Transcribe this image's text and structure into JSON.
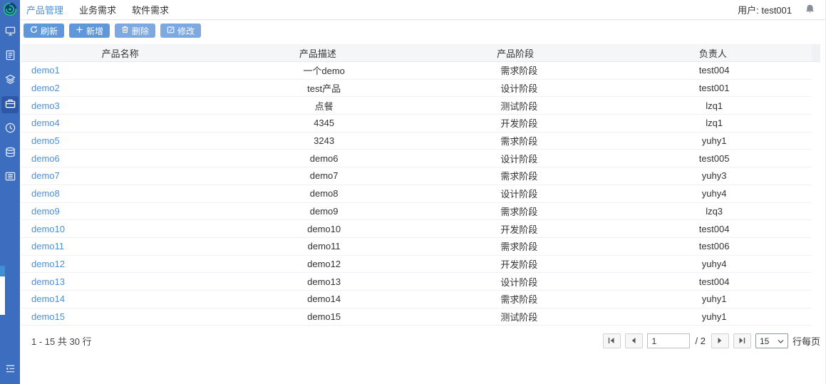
{
  "colors": {
    "sidebar": "#3d6dbf",
    "accent": "#4a90db",
    "button_primary": "#5f97d8",
    "button_muted": "#7da8e0",
    "logo_green": "#2abd87"
  },
  "sidebar": {
    "logo_icon": "spiral-logo-icon",
    "items": [
      {
        "icon": "monitor-icon",
        "active": false
      },
      {
        "icon": "document-icon",
        "active": false
      },
      {
        "icon": "layers-icon",
        "active": false
      },
      {
        "icon": "briefcase-icon",
        "active": true
      },
      {
        "icon": "clock-icon",
        "active": false
      },
      {
        "icon": "database-icon",
        "active": false
      },
      {
        "icon": "list-icon",
        "active": false
      }
    ],
    "collapse_icon": "collapse-menu-icon"
  },
  "topbar": {
    "tabs": [
      {
        "label": "产品管理",
        "active": true
      },
      {
        "label": "业务需求",
        "active": false
      },
      {
        "label": "软件需求",
        "active": false
      }
    ],
    "user_label": "用户: test001",
    "bell_icon": "bell-icon"
  },
  "toolbar": {
    "buttons": [
      {
        "label": "刷新",
        "icon": "refresh-icon"
      },
      {
        "label": "新增",
        "icon": "plus-icon"
      },
      {
        "label": "删除",
        "icon": "trash-icon"
      },
      {
        "label": "修改",
        "icon": "edit-icon"
      }
    ]
  },
  "table": {
    "columns": [
      "产品名称",
      "产品描述",
      "产品阶段",
      "负责人"
    ],
    "rows": [
      [
        "demo1",
        "一个demo",
        "需求阶段",
        "test004"
      ],
      [
        "demo2",
        "test产品",
        "设计阶段",
        "test001"
      ],
      [
        "demo3",
        "点餐",
        "测试阶段",
        "lzq1"
      ],
      [
        "demo4",
        "4345",
        "开发阶段",
        "lzq1"
      ],
      [
        "demo5",
        "3243",
        "需求阶段",
        "yuhy1"
      ],
      [
        "demo6",
        "demo6",
        "设计阶段",
        "test005"
      ],
      [
        "demo7",
        "demo7",
        "需求阶段",
        "yuhy3"
      ],
      [
        "demo8",
        "demo8",
        "设计阶段",
        "yuhy4"
      ],
      [
        "demo9",
        "demo9",
        "需求阶段",
        "lzq3"
      ],
      [
        "demo10",
        "demo10",
        "开发阶段",
        "test004"
      ],
      [
        "demo11",
        "demo11",
        "需求阶段",
        "test006"
      ],
      [
        "demo12",
        "demo12",
        "开发阶段",
        "yuhy4"
      ],
      [
        "demo13",
        "demo13",
        "设计阶段",
        "test004"
      ],
      [
        "demo14",
        "demo14",
        "需求阶段",
        "yuhy1"
      ],
      [
        "demo15",
        "demo15",
        "测试阶段",
        "yuhy1"
      ]
    ]
  },
  "footer": {
    "count_text": "1 - 15 共 30 行",
    "page_value": "1",
    "total_pages": "/ 2",
    "page_size": "15",
    "page_size_label": "行每页"
  }
}
